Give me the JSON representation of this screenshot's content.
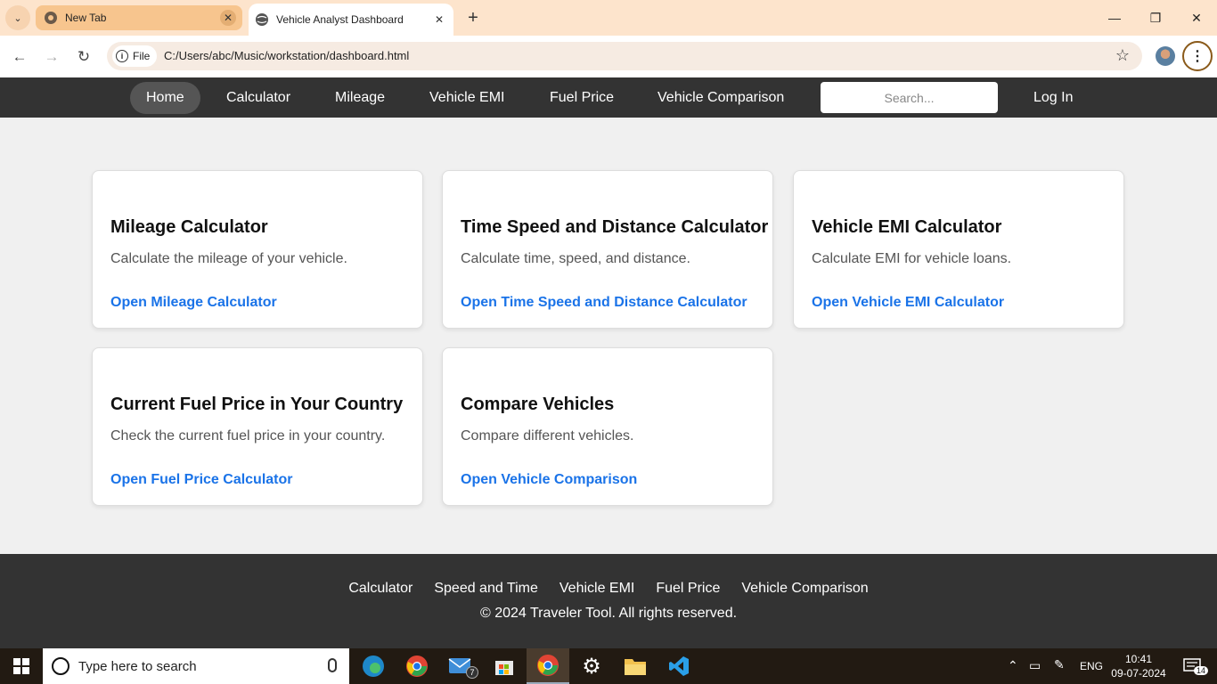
{
  "browser": {
    "tabs": [
      {
        "title": "New Tab",
        "active": false
      },
      {
        "title": "Vehicle Analyst Dashboard",
        "active": true
      }
    ],
    "address": {
      "chip_label": "File",
      "url": "C:/Users/abc/Music/workstation/dashboard.html"
    }
  },
  "navbar": {
    "items": [
      {
        "label": "Home",
        "active": true
      },
      {
        "label": "Calculator",
        "active": false
      },
      {
        "label": "Mileage",
        "active": false
      },
      {
        "label": "Vehicle EMI",
        "active": false
      },
      {
        "label": "Fuel Price",
        "active": false
      },
      {
        "label": "Vehicle Comparison",
        "active": false
      }
    ],
    "search_placeholder": "Search...",
    "login_label": "Log In"
  },
  "cards": [
    {
      "title": "Mileage Calculator",
      "description": "Calculate the mileage of your vehicle.",
      "link": "Open Mileage Calculator"
    },
    {
      "title": "Time Speed and Distance Calculator",
      "description": "Calculate time, speed, and distance.",
      "link": "Open Time Speed and Distance Calculator"
    },
    {
      "title": "Vehicle EMI Calculator",
      "description": "Calculate EMI for vehicle loans.",
      "link": "Open Vehicle EMI Calculator"
    },
    {
      "title": "Current Fuel Price in Your Country",
      "description": "Check the current fuel price in your country.",
      "link": "Open Fuel Price Calculator"
    },
    {
      "title": "Compare Vehicles",
      "description": "Compare different vehicles.",
      "link": "Open Vehicle Comparison"
    }
  ],
  "footer": {
    "links": [
      "Calculator",
      "Speed and Time",
      "Vehicle EMI",
      "Fuel Price",
      "Vehicle Comparison"
    ],
    "copyright": "© 2024 Traveler Tool. All rights reserved."
  },
  "taskbar": {
    "search_placeholder": "Type here to search",
    "mail_badge": "7",
    "language": "ENG",
    "time": "10:41",
    "date": "09-07-2024",
    "notification_count": "14"
  },
  "colors": {
    "link": "#1a73e8",
    "navbar_bg": "#333333",
    "page_bg": "#f0f0f0",
    "tabstrip_bg": "#fde4cc"
  }
}
